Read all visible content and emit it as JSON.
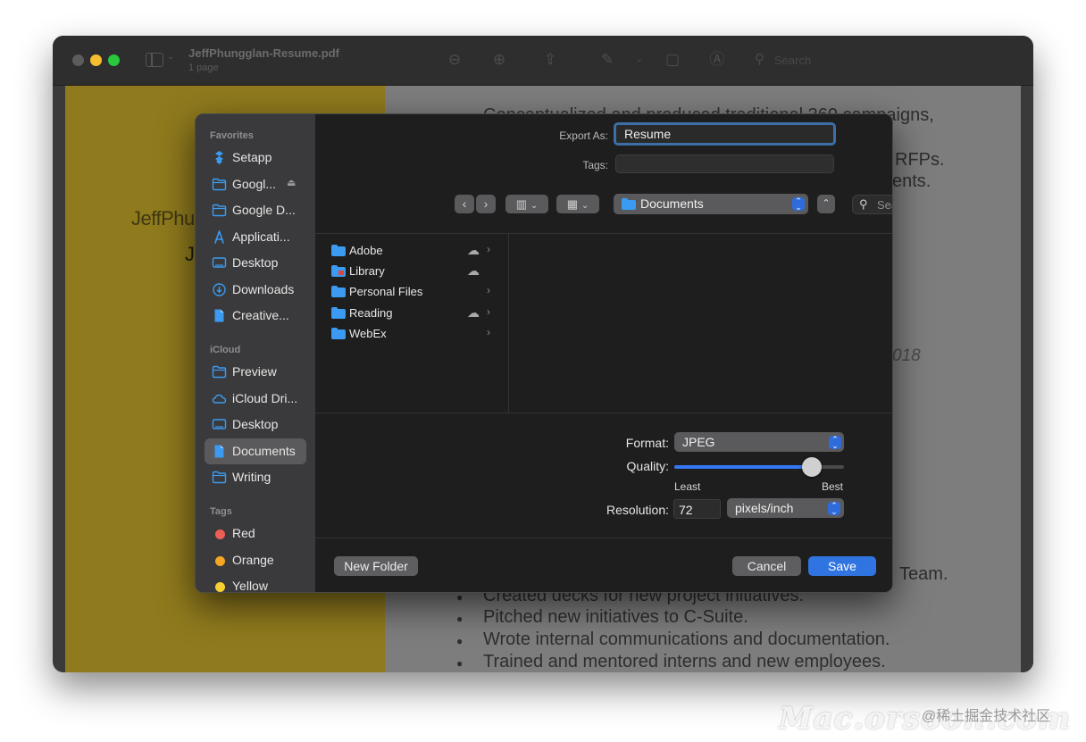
{
  "window": {
    "document_title": "JeffPhungglan-Resume.pdf",
    "document_subtitle": "1 page",
    "search_placeholder": "Search"
  },
  "background_document": {
    "name_line": "JeffPhu",
    "name_initial": "J",
    "lines": [
      "Conceptualized and produced traditional 360 campaigns,",
      "RFPs.",
      "ents.",
      "Team.",
      "Created decks for new project initiatives.",
      "Pitched new initiatives to C-Suite.",
      "Wrote internal communications and documentation.",
      "Trained and mentored interns and new employees."
    ],
    "year_fragment": "018"
  },
  "dialog": {
    "export_as_label": "Export As:",
    "export_as_value": "Resume",
    "tags_label": "Tags:",
    "tags_value": "",
    "location": "Documents",
    "search_placeholder": "Search",
    "sidebar": {
      "favorites_heading": "Favorites",
      "favorites": [
        {
          "label": "Setapp",
          "icon": "setapp-icon"
        },
        {
          "label": "Googl...",
          "icon": "folder-icon",
          "eject": true
        },
        {
          "label": "Google D...",
          "icon": "folder-icon"
        },
        {
          "label": "Applicati...",
          "icon": "applications-icon"
        },
        {
          "label": "Desktop",
          "icon": "desktop-icon"
        },
        {
          "label": "Downloads",
          "icon": "downloads-icon"
        },
        {
          "label": "Creative...",
          "icon": "document-icon"
        }
      ],
      "icloud_heading": "iCloud",
      "icloud": [
        {
          "label": "Preview",
          "icon": "folder-icon"
        },
        {
          "label": "iCloud Dri...",
          "icon": "cloud-icon"
        },
        {
          "label": "Desktop",
          "icon": "desktop-icon"
        },
        {
          "label": "Documents",
          "icon": "document-icon",
          "selected": true
        },
        {
          "label": "Writing",
          "icon": "folder-icon"
        }
      ],
      "tags_heading": "Tags",
      "tags": [
        {
          "label": "Red",
          "color": "#ec5f57"
        },
        {
          "label": "Orange",
          "color": "#f5a623"
        },
        {
          "label": "Yellow",
          "color": "#f7cf33"
        }
      ]
    },
    "files": [
      {
        "name": "Adobe",
        "cloud": true,
        "arrow": true
      },
      {
        "name": "Library",
        "cloud": true,
        "arrow": false
      },
      {
        "name": "Personal Files",
        "cloud": false,
        "arrow": true
      },
      {
        "name": "Reading",
        "cloud": true,
        "arrow": true
      },
      {
        "name": "WebEx",
        "cloud": false,
        "arrow": true
      }
    ],
    "format_label": "Format:",
    "format_value": "JPEG",
    "quality_label": "Quality:",
    "quality_value": 0.81,
    "quality_min_label": "Least",
    "quality_max_label": "Best",
    "resolution_label": "Resolution:",
    "resolution_value": "72",
    "resolution_unit": "pixels/inch",
    "new_folder_label": "New Folder",
    "cancel_label": "Cancel",
    "save_label": "Save"
  },
  "colors": {
    "accent": "#2f74e0",
    "folder": "#3a9bf0"
  },
  "watermark": {
    "text": "Mac.orsoon.com",
    "credit": "@稀土掘金技术社区"
  }
}
